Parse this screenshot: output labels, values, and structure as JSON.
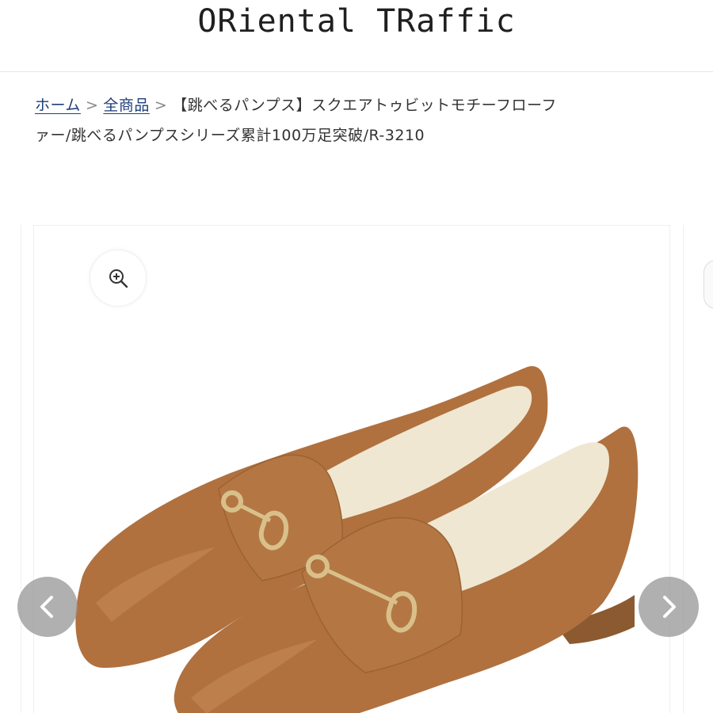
{
  "header": {
    "logo_text": "ORiental TRaffic"
  },
  "breadcrumb": {
    "home": "ホーム",
    "all_products": "全商品",
    "separator": ">",
    "current_line1": "【跳べるパンプス】スクエアトゥビットモチーフローフ",
    "current_line2": "ァー/跳べるパンプスシリーズ累計100万足突破/R-3210"
  },
  "gallery": {
    "zoom_icon": "zoom-in-icon",
    "prev_icon": "chevron-left-icon",
    "next_icon": "chevron-right-icon",
    "product_color": "#b0713f",
    "lining_color": "#efe7d2",
    "hardware_color": "#d9c08a"
  }
}
